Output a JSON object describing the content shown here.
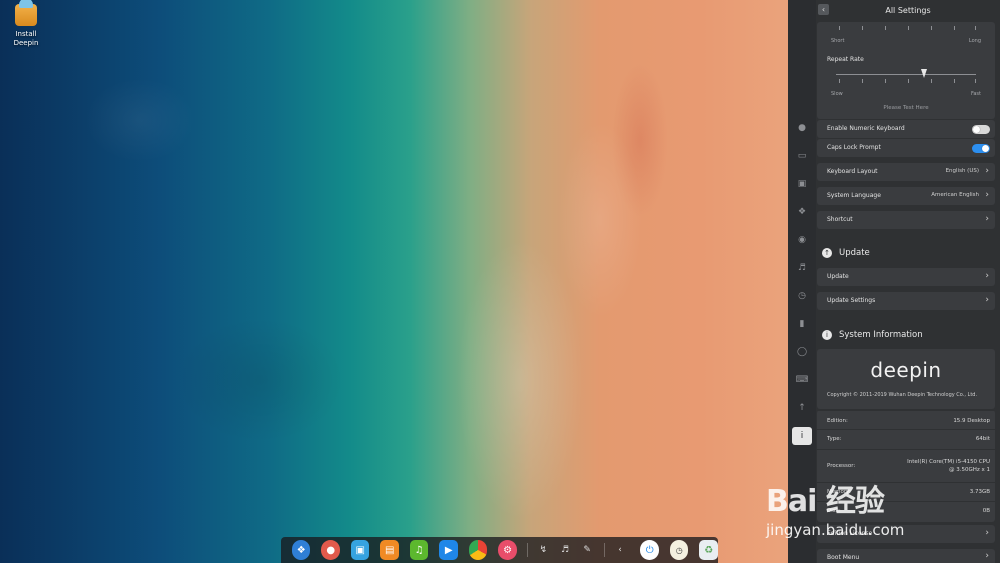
{
  "desktop": {
    "icon_label": "Install Deepin"
  },
  "settings": {
    "title": "All Settings",
    "keyboard": {
      "delay_short": "Short",
      "delay_long": "Long",
      "repeat_rate_label": "Repeat Rate",
      "repeat_rate_level": 0.63,
      "rate_slow": "Slow",
      "rate_fast": "Fast",
      "test_placeholder": "Please Test Here",
      "numeric_keyboard_label": "Enable Numeric Keyboard",
      "numeric_keyboard_on": false,
      "caps_lock_label": "Caps Lock Prompt",
      "caps_lock_on": true,
      "layout_label": "Keyboard Layout",
      "layout_value": "English (US)",
      "language_label": "System Language",
      "language_value": "American English",
      "shortcut_label": "Shortcut"
    },
    "update": {
      "section_title": "Update",
      "update_label": "Update",
      "update_settings_label": "Update Settings"
    },
    "system_info": {
      "section_title": "System Information",
      "logo_text": "deepin",
      "copyright": "Copyright © 2011-2019 Wuhan Deepin Technology Co., Ltd.",
      "edition_label": "Edition:",
      "edition_value": "15.9 Desktop",
      "type_label": "Type:",
      "type_value": "64bit",
      "processor_label": "Processor:",
      "processor_value_1": "Intel(R) Core(TM) i5-4150 CPU",
      "processor_value_2": "@ 3.50GHz x 1",
      "memory_label": "Memory:",
      "memory_value": "3.73GB",
      "disk_label": "Disk:",
      "disk_value": "0B",
      "license_label": "Edition License",
      "boot_menu_label": "Boot Menu"
    }
  },
  "watermark": {
    "big": "Bai 经验",
    "small": "jingyan.baidu.com"
  }
}
